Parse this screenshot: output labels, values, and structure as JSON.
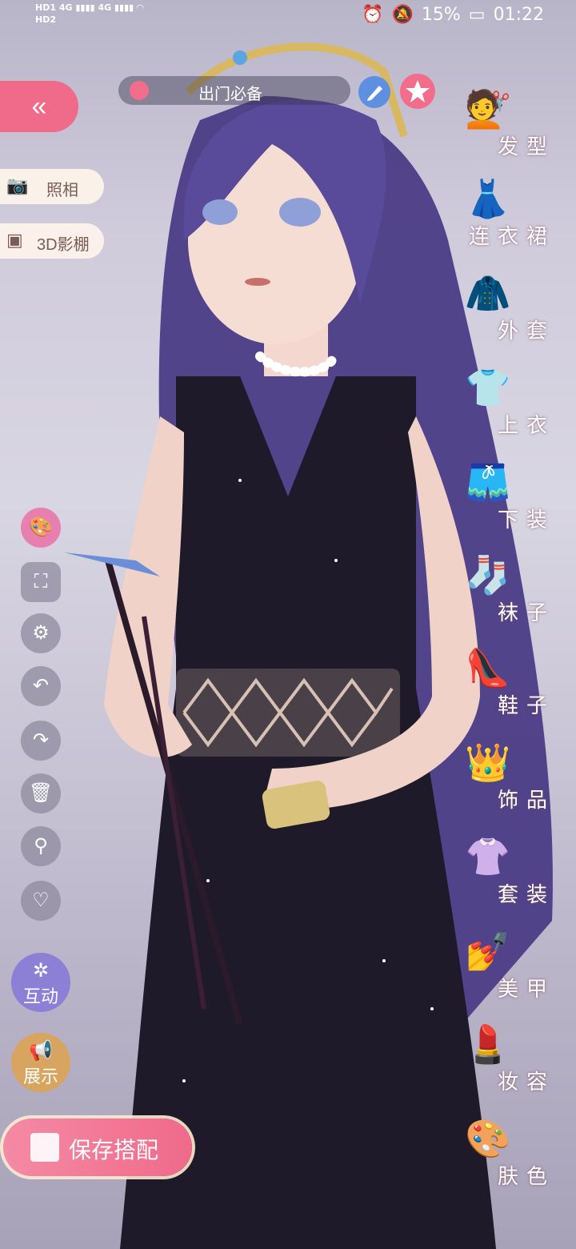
{
  "status_bar": {
    "left": [
      "HD1",
      "HD2",
      "4G",
      "4G"
    ],
    "battery": "15%",
    "time": "01:22"
  },
  "outfit": {
    "name": "出门必备"
  },
  "left_panel": {
    "back_glyph": "«",
    "photo": "照相",
    "studio": "3D影棚",
    "interact": "互动",
    "display": "展示",
    "save": "保存搭配"
  },
  "tools": [
    "palette-icon",
    "fullscreen-icon",
    "gear-icon",
    "undo-icon",
    "redo-icon",
    "trash-icon",
    "search-icon",
    "heart-icon"
  ],
  "categories": [
    {
      "label": "发型",
      "icon": "hair-icon"
    },
    {
      "label": "连衣裙",
      "icon": "dress-icon"
    },
    {
      "label": "外套",
      "icon": "coat-icon"
    },
    {
      "label": "上衣",
      "icon": "shirt-icon"
    },
    {
      "label": "下装",
      "icon": "shorts-icon"
    },
    {
      "label": "袜子",
      "icon": "sock-icon"
    },
    {
      "label": "鞋子",
      "icon": "shoe-icon"
    },
    {
      "label": "饰品",
      "icon": "tiara-icon"
    },
    {
      "label": "套装",
      "icon": "outfit-icon"
    },
    {
      "label": "美甲",
      "icon": "nail-polish-icon"
    },
    {
      "label": "妆容",
      "icon": "makeup-icon"
    },
    {
      "label": "肤色",
      "icon": "skin-palette-icon"
    }
  ]
}
